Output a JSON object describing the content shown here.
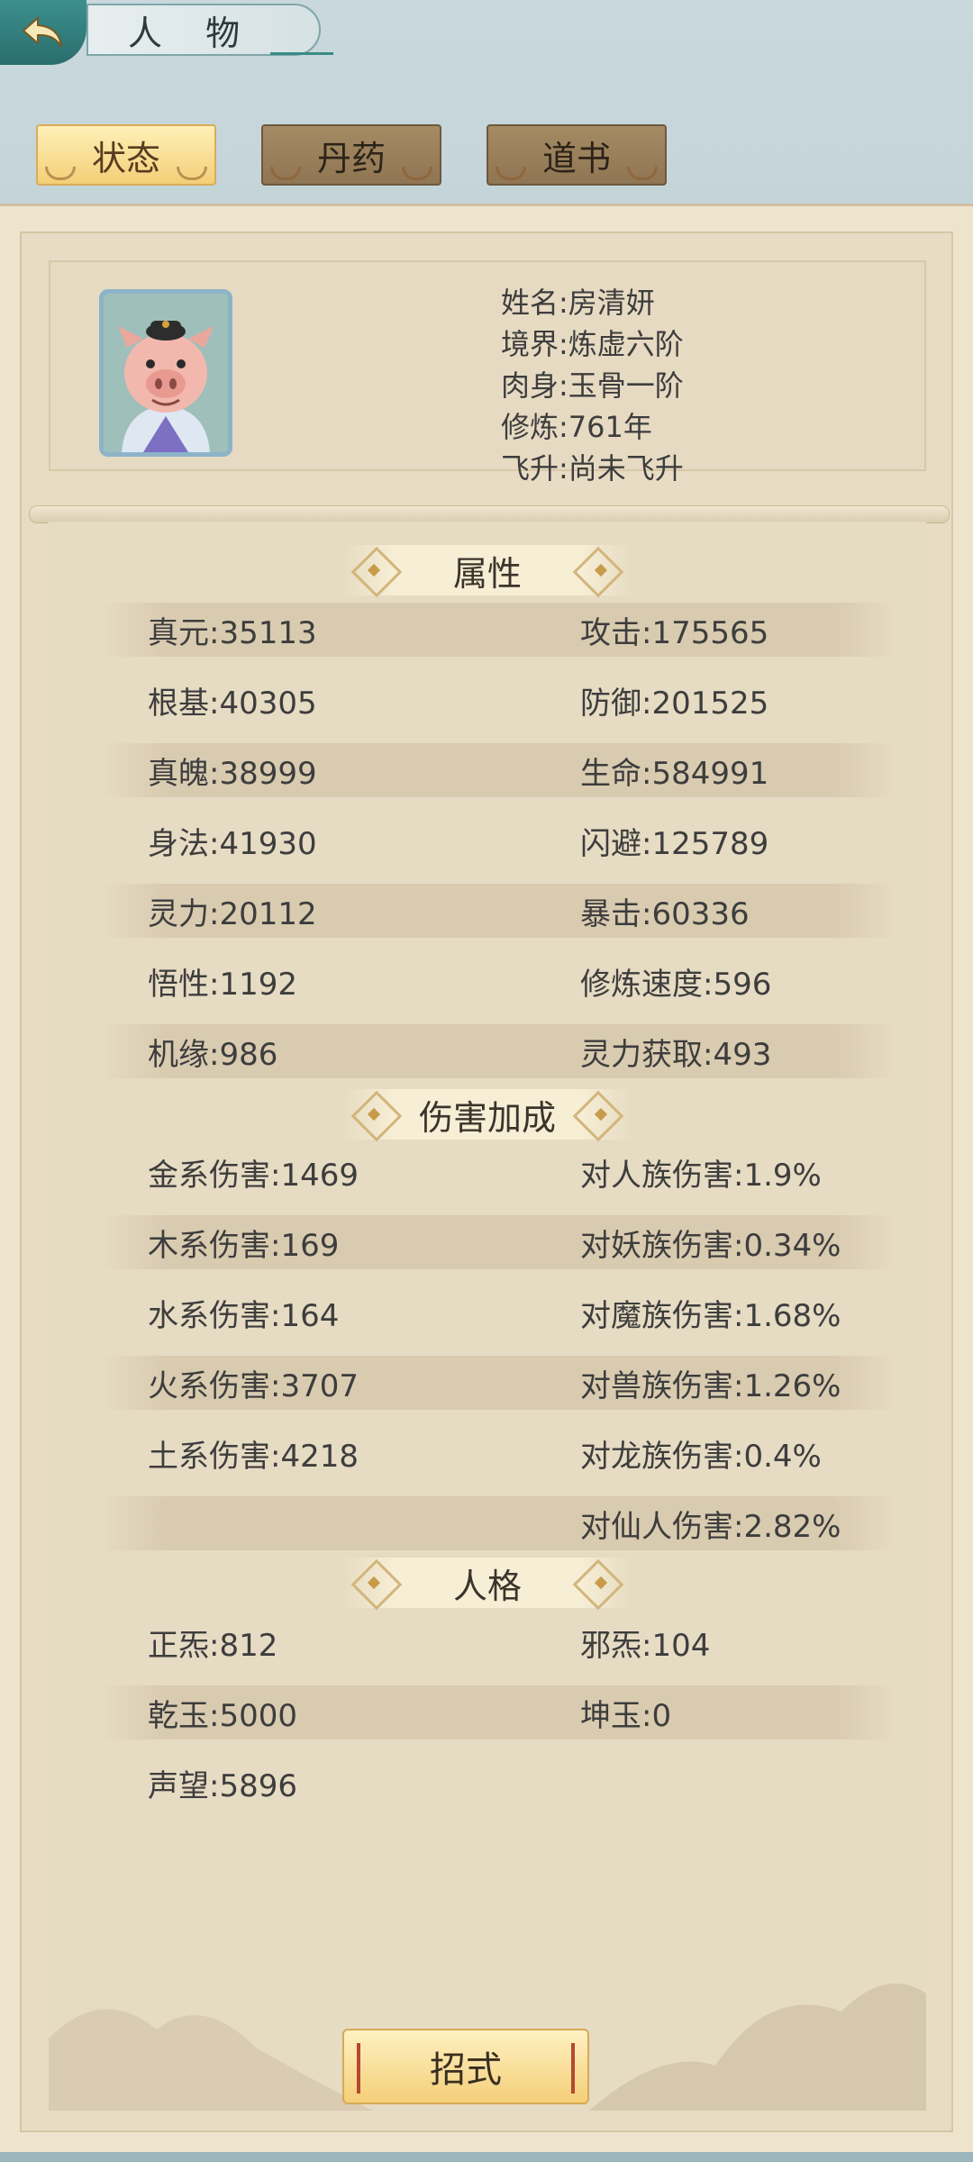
{
  "header": {
    "title": "人 物",
    "back_icon": "back-arrow-icon"
  },
  "tabs": [
    {
      "label": "状态",
      "active": true
    },
    {
      "label": "丹药",
      "active": false
    },
    {
      "label": "道书",
      "active": false
    }
  ],
  "profile": {
    "avatar_icon": "pig-character-icon",
    "name": "姓名:房清妍",
    "realm": "境界:炼虚六阶",
    "body": "肉身:玉骨一阶",
    "cultivation": "修炼:761年",
    "ascension": "飞升:尚未飞升"
  },
  "sections": {
    "attributes": {
      "title": "属性",
      "rows": [
        [
          "真元:35113",
          "攻击:175565"
        ],
        [
          "根基:40305",
          "防御:201525"
        ],
        [
          "真魄:38999",
          "生命:584991"
        ],
        [
          "身法:41930",
          "闪避:125789"
        ],
        [
          "灵力:20112",
          "暴击:60336"
        ],
        [
          "悟性:1192",
          "修炼速度:596"
        ],
        [
          "机缘:986",
          "灵力获取:493"
        ]
      ]
    },
    "damage": {
      "title": "伤害加成",
      "rows": [
        [
          "金系伤害:1469",
          "对人族伤害:1.9%"
        ],
        [
          "木系伤害:169",
          "对妖族伤害:0.34%"
        ],
        [
          "水系伤害:164",
          "对魔族伤害:1.68%"
        ],
        [
          "火系伤害:3707",
          "对兽族伤害:1.26%"
        ],
        [
          "土系伤害:4218",
          "对龙族伤害:0.4%"
        ],
        [
          "",
          "对仙人伤害:2.82%"
        ]
      ]
    },
    "personality": {
      "title": "人格",
      "rows": [
        [
          "正炁:812",
          "邪炁:104"
        ],
        [
          "乾玉:5000",
          "坤玉:0"
        ],
        [
          "声望:5896",
          ""
        ]
      ]
    }
  },
  "footer": {
    "move_label": "招式"
  }
}
